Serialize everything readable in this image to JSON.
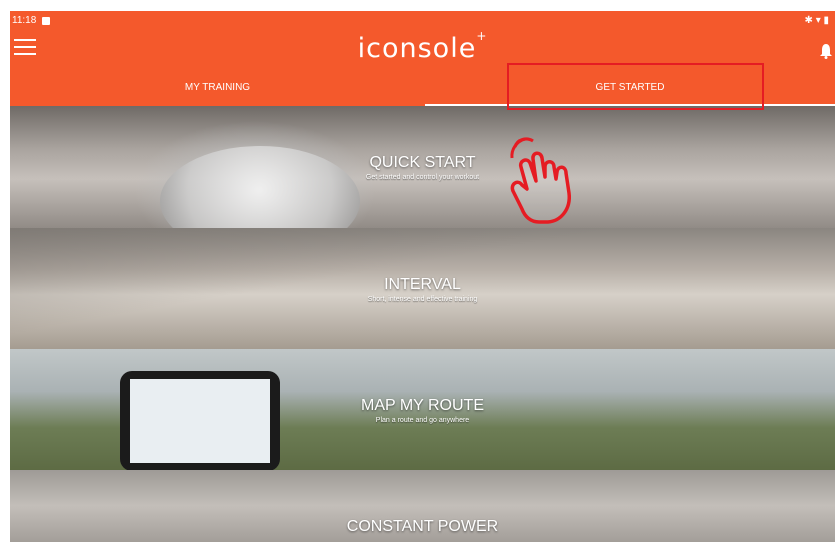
{
  "status_bar": {
    "time": "11:18",
    "right_icons": "✱ ▾ ▮"
  },
  "header": {
    "logo_text": "iconsole",
    "logo_sup": "+"
  },
  "tabs": [
    {
      "label": "MY TRAINING",
      "active": false
    },
    {
      "label": "GET STARTED",
      "active": true
    }
  ],
  "workouts": [
    {
      "title": "QUICK START",
      "subtitle": "Get started and control your workout"
    },
    {
      "title": "INTERVAL",
      "subtitle": "Short, intense and effective training"
    },
    {
      "title": "MAP MY ROUTE",
      "subtitle": "Plan a route and go anywhere"
    },
    {
      "title": "CONSTANT POWER",
      "subtitle": ""
    }
  ],
  "colors": {
    "accent": "#f4592c",
    "highlight": "#e51c23"
  },
  "icons": {
    "menu": "hamburger-menu-icon",
    "bell": "bell-icon",
    "hand": "tap-hand-icon"
  }
}
